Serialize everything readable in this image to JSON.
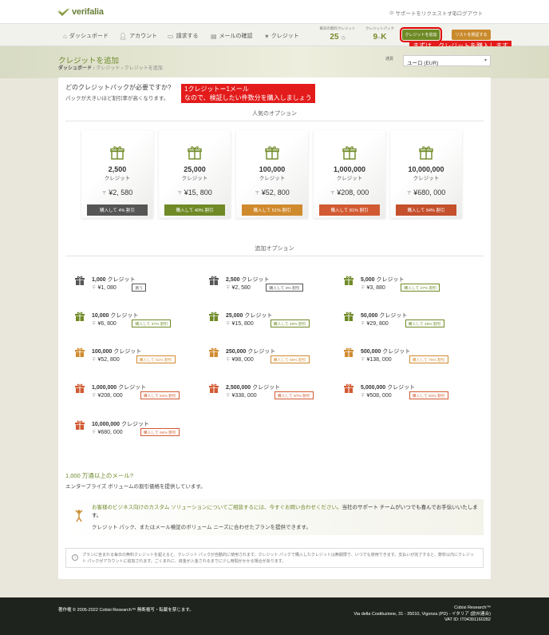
{
  "topbar": {
    "logo_text": "verifalia",
    "support_link": "サポートをリクエストする",
    "logout_link": "ログアウト"
  },
  "nav": {
    "items": [
      {
        "label": "ダッシュボード",
        "icon": "home-icon"
      },
      {
        "label": "アカウント",
        "icon": "user-icon"
      },
      {
        "label": "請求する",
        "icon": "card-icon"
      },
      {
        "label": "メールの確認",
        "icon": "document-icon"
      },
      {
        "label": "クレジット",
        "icon": "heart-icon"
      }
    ],
    "daily_credits_label": "毎日の無料クレジット",
    "daily_credits_value": "25",
    "credit_packs_label": "クレジットパック",
    "credit_packs_value": "9",
    "credit_packs_suffix": "K",
    "add_credits_button": "クレジットを追加",
    "verify_list_button": "リストを検証する"
  },
  "annotations": {
    "buy_first": "まずは、クレジットを購入します",
    "credit_note_line1": "1クレジット＝1メール",
    "credit_note_line2": "なので、検証したい件数分を購入しましょう"
  },
  "header": {
    "title": "クレジットを追加",
    "breadcrumb_home": "ダッシュボード",
    "breadcrumb_sep": "›",
    "breadcrumb_credits": "クレジット",
    "breadcrumb_current": "クレジットを追加",
    "currency_label": "通貨",
    "currency_value": "ユーロ (EUR)"
  },
  "intro": {
    "question": "どのクレジットパックが必要ですか?",
    "subtitle": "パックが大きいほど割引率が高くなります。"
  },
  "popular": {
    "title": "人気のオプション",
    "cards": [
      {
        "amount": "2,500",
        "unit": "クレジット",
        "currency": "〒",
        "price": "¥2, 580",
        "button": "購入して 4% 割引",
        "color": "#555555"
      },
      {
        "amount": "25,000",
        "unit": "クレジット",
        "currency": "〒",
        "price": "¥15, 800",
        "button": "購入して 40% 割引",
        "color": "#6f8a26"
      },
      {
        "amount": "100,000",
        "unit": "クレジット",
        "currency": "〒",
        "price": "¥52, 800",
        "button": "購入して 51% 割引",
        "color": "#d08a2e"
      },
      {
        "amount": "1,000,000",
        "unit": "クレジット",
        "currency": "〒",
        "price": "¥208, 000",
        "button": "購入して 81% 割引",
        "color": "#d25a32"
      },
      {
        "amount": "10,000,000",
        "unit": "クレジット",
        "currency": "〒",
        "price": "¥680, 000",
        "button": "購入して 94% 割引",
        "color": "#c4502c"
      }
    ]
  },
  "additional": {
    "title": "追加オプション",
    "unit": "クレジット",
    "currency": "〒",
    "items": [
      {
        "amount": "1,000",
        "price": "¥1, 080",
        "tag": "買う",
        "color": "#555555"
      },
      {
        "amount": "2,500",
        "price": "¥2, 580",
        "tag": "購入して 4% 割引",
        "color": "#555555"
      },
      {
        "amount": "5,000",
        "price": "¥3, 880",
        "tag": "購入して 27% 割引",
        "color": "#6f8a26"
      },
      {
        "amount": "10,000",
        "price": "¥6, 800",
        "tag": "購入して 37% 割引",
        "color": "#6f8a26"
      },
      {
        "amount": "25,000",
        "price": "¥15, 800",
        "tag": "購入して 40% 割引",
        "color": "#6f8a26"
      },
      {
        "amount": "50,000",
        "price": "¥29, 800",
        "tag": "購入して 45% 割引",
        "color": "#6f8a26"
      },
      {
        "amount": "100,000",
        "price": "¥52, 800",
        "tag": "購入して 51% 割引",
        "color": "#d08a2e"
      },
      {
        "amount": "250,000",
        "price": "¥98, 000",
        "tag": "購入して 65% 割引",
        "color": "#d08a2e"
      },
      {
        "amount": "500,000",
        "price": "¥138, 000",
        "tag": "購入して 75% 割引",
        "color": "#d08a2e"
      },
      {
        "amount": "1,000,000",
        "price": "¥208, 000",
        "tag": "購入して 81% 割引",
        "color": "#d25a32"
      },
      {
        "amount": "2,500,000",
        "price": "¥338, 000",
        "tag": "購入して 87% 割引",
        "color": "#d25a32"
      },
      {
        "amount": "5,000,000",
        "price": "¥508, 000",
        "tag": "購入して 91% 割引",
        "color": "#d25a32"
      },
      {
        "amount": "10,000,000",
        "price": "¥680, 000",
        "tag": "購入して 94% 割引",
        "color": "#d25a32"
      }
    ]
  },
  "enterprise": {
    "title": "1,000 万通以上のメール?",
    "subtitle": "エンタープライズ ボリュームの割引価格を提供しています。",
    "contact_green": "お客様のビジネス向けのカスタム ソリューションについてご相談するには、今すぐお問い合わせください。",
    "contact_black": "当社のサポート チームがいつでも喜んでお手伝いいたします。",
    "contact_line2": "クレジット パック、またはメール検証のボリューム ニーズに合わせたプランを提供できます。"
  },
  "info": {
    "text": "プランに含まれる毎日の無料クレジットを超えると、クレジット パックが自動的に使用されます。クレジット パックで購入したクレジットは無期限で、いつでも使用できます。支払いが完了すると、数秒以内にクレジット パックがアカウントに追加されます。ごくまれに、資金が入金されるまでに少し時間がかかる場合があります。"
  },
  "footer": {
    "copyright": "著作権 © 2005-2022 Cobisi Research™ 無断複写・転載を禁じます。",
    "company": "Cobisi Research™",
    "address": "Via della Costituzione, 31 - 35010, Vigonza (PD) - イタリア (欧州連合)",
    "vat": "VAT ID: IT04391160282"
  },
  "colors": {
    "brand_green": "#6f8a26",
    "orange": "#d08a2e",
    "red_orange": "#d25a32",
    "annotation_red": "#e31b1b"
  }
}
